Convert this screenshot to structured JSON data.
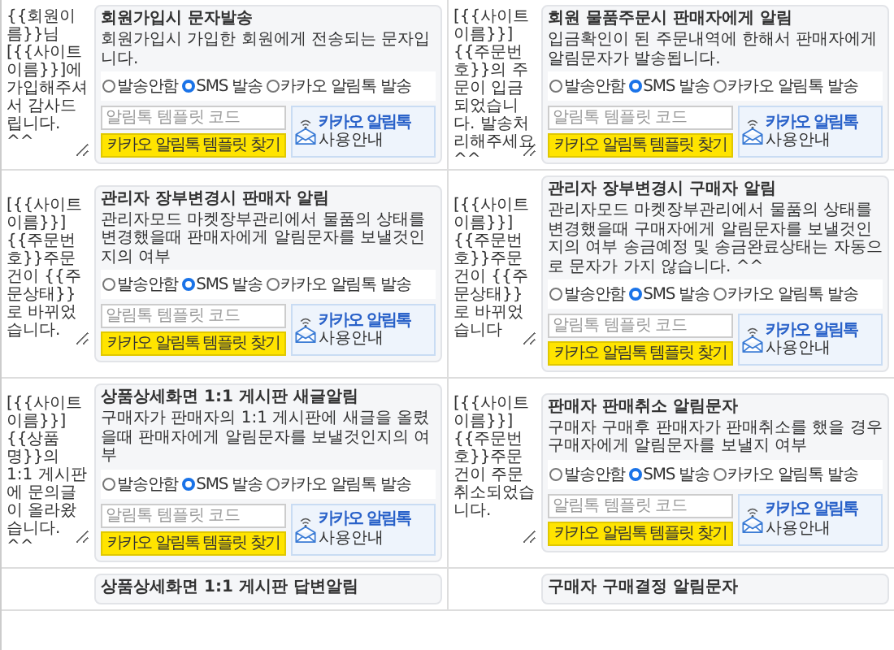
{
  "rows": [
    {
      "cells": [
        {
          "message": "{{회원이름}}님 [{{사이트이름}}]에 가입해주셔서 감사드립니다. ^^",
          "title": "회원가입시 문자발송",
          "description": "회원가입시 가입한 회원에게 전송되는 문자입니다.",
          "options": [
            {
              "label": "발송안함",
              "selected": false
            },
            {
              "label": "SMS 발송",
              "selected": true
            },
            {
              "label": "카카오 알림톡 발송",
              "selected": false
            }
          ],
          "code_placeholder": "알림톡 템플릿 코드",
          "find_button": "카카오 알림톡 템플릿 찾기",
          "guide": {
            "title": "카카오 알림톡",
            "subtitle": "사용안내"
          }
        },
        {
          "message": "[{{사이트이름}}] {{주문번호}}의 주문이 입금되었습니다. 발송처리해주세요 ^^",
          "title": "회원 물품주문시 판매자에게 알림",
          "description": "입금확인이 된 주문내역에 한해서 판매자에게 알림문자가 발송됩니다.",
          "options": [
            {
              "label": "발송안함",
              "selected": false
            },
            {
              "label": "SMS 발송",
              "selected": true
            },
            {
              "label": "카카오 알림톡 발송",
              "selected": false
            }
          ],
          "code_placeholder": "알림톡 템플릿 코드",
          "find_button": "카카오 알림톡 템플릿 찾기",
          "guide": {
            "title": "카카오 알림톡",
            "subtitle": "사용안내"
          }
        }
      ]
    },
    {
      "cells": [
        {
          "message": "[{{사이트이름}}] {{주문번호}}주문건이 {{주문상태}}로 바뀌었습니다.",
          "title": "관리자 장부변경시 판매자 알림",
          "description": "관리자모드 마켓장부관리에서 물품의 상태를 변경했을때 판매자에게 알림문자를 보낼것인지의 여부",
          "options": [
            {
              "label": "발송안함",
              "selected": false
            },
            {
              "label": "SMS 발송",
              "selected": true
            },
            {
              "label": "카카오 알림톡 발송",
              "selected": false
            }
          ],
          "code_placeholder": "알림톡 템플릿 코드",
          "find_button": "카카오 알림톡 템플릿 찾기",
          "guide": {
            "title": "카카오 알림톡",
            "subtitle": "사용안내"
          }
        },
        {
          "message": "[{{사이트이름}}] {{주문번호}}주문건이 {{주문상태}}로 바뀌었습니다",
          "title": "관리자 장부변경시 구매자 알림",
          "description": "관리자모드 마켓장부관리에서 물품의 상태를 변경했을때 구매자에게 알림문자를 보낼것인지의 여부 송금예정 및 송금완료상태는 자동으로 문자가 가지 않습니다. ^^",
          "options": [
            {
              "label": "발송안함",
              "selected": false
            },
            {
              "label": "SMS 발송",
              "selected": true
            },
            {
              "label": "카카오 알림톡 발송",
              "selected": false
            }
          ],
          "code_placeholder": "알림톡 템플릿 코드",
          "find_button": "카카오 알림톡 템플릿 찾기",
          "guide": {
            "title": "카카오 알림톡",
            "subtitle": "사용안내"
          }
        }
      ]
    },
    {
      "cells": [
        {
          "message": "[{{사이트이름}}] {{상품명}}의 1:1 게시판에 문의글이 올라왔습니다. ^^",
          "title": "상품상세화면 1:1 게시판 새글알림",
          "description": "구매자가 판매자의 1:1 게시판에 새글을 올렸을때 판매자에게 알림문자를 보낼것인지의 여부",
          "options": [
            {
              "label": "발송안함",
              "selected": false
            },
            {
              "label": "SMS 발송",
              "selected": true
            },
            {
              "label": "카카오 알림톡 발송",
              "selected": false
            }
          ],
          "code_placeholder": "알림톡 템플릿 코드",
          "find_button": "카카오 알림톡 템플릿 찾기",
          "guide": {
            "title": "카카오 알림톡",
            "subtitle": "사용안내"
          }
        },
        {
          "message": "[{{사이트이름}}] {{주문번호}}주문건이 주문취소되었습니다.",
          "title": "판매자 판매취소 알림문자",
          "description": "구매자 구매후 판매자가 판매취소를 했을 경우 구매자에게 알림문자를 보낼지 여부",
          "options": [
            {
              "label": "발송안함",
              "selected": false
            },
            {
              "label": "SMS 발송",
              "selected": true
            },
            {
              "label": "카카오 알림톡 발송",
              "selected": false
            }
          ],
          "code_placeholder": "알림톡 템플릿 코드",
          "find_button": "카카오 알림톡 템플릿 찾기",
          "guide": {
            "title": "카카오 알림톡",
            "subtitle": "사용안내"
          }
        }
      ]
    },
    {
      "cells": [
        {
          "title": "상품상세화면 1:1 게시판 답변알림"
        },
        {
          "title": "구매자 구매결정 알림문자"
        }
      ]
    }
  ]
}
